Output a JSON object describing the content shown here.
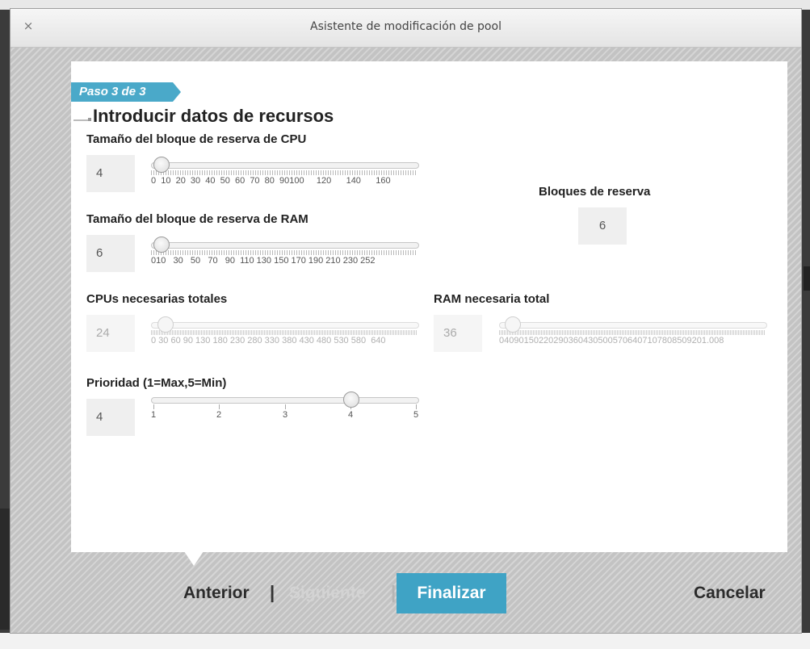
{
  "window": {
    "title": "Asistente de modificación de pool",
    "close_label": "×"
  },
  "step": {
    "label": "Paso 3 de 3"
  },
  "section": {
    "title": "Introducir datos de recursos"
  },
  "cpu_block": {
    "label": "Tamaño del bloque de reserva de CPU",
    "value": "4",
    "min": 0,
    "max": 160,
    "scale": "0  10  20  30  40  50  60  70  80  90100     120      140      160"
  },
  "reserve_blocks": {
    "label": "Bloques de reserva",
    "value": "6"
  },
  "ram_block": {
    "label": "Tamaño del bloque de reserva de RAM",
    "value": "6",
    "min": 0,
    "max": 252,
    "scale": "010   30   50   70   90  110 130 150 170 190 210 230 252"
  },
  "cpus_total": {
    "label": "CPUs necesarias totales",
    "value": "24",
    "min": 0,
    "max": 640,
    "scale": "0 30 60 90 130 180 230 280 330 380 430 480 530 580  640"
  },
  "ram_total": {
    "label": "RAM necesaria total",
    "value": "36",
    "min": 0,
    "max": 1008,
    "scale": "040901502202903604305005706407107808509201.008"
  },
  "priority": {
    "label": "Prioridad (1=Max,5=Min)",
    "value": "4",
    "min": 1,
    "max": 5,
    "ticks": [
      "1",
      "2",
      "3",
      "4",
      "5"
    ]
  },
  "footer": {
    "previous": "Anterior",
    "separator": "|",
    "next": "Siguiente",
    "finish": "Finalizar",
    "cancel": "Cancelar"
  },
  "colors": {
    "accent": "#3fa3c5",
    "step_tag": "#4aa9c9"
  }
}
